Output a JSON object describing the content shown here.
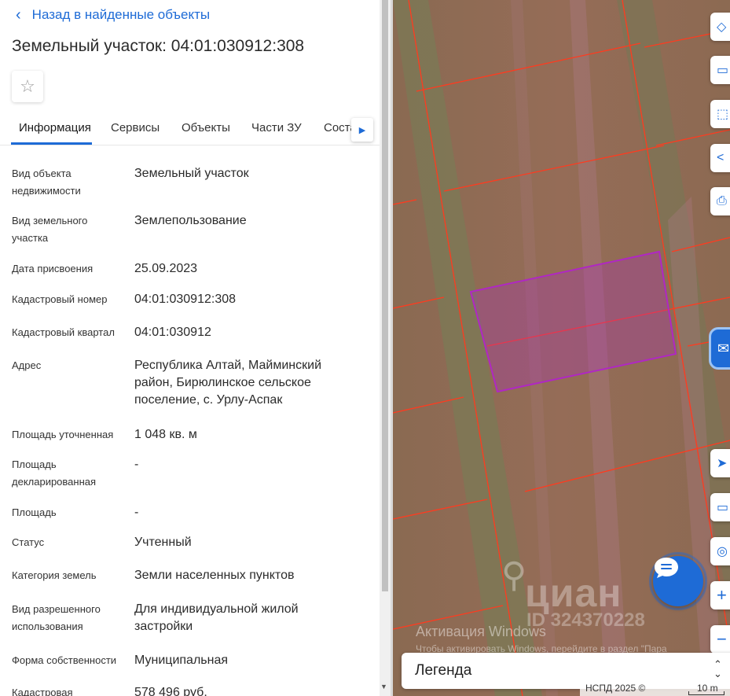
{
  "header": {
    "back_label": "Назад в найденные объекты",
    "title": "Земельный участок: 04:01:030912:308",
    "favorite_icon": "star-outline-icon"
  },
  "tabs": [
    {
      "label": "Информация",
      "active": true
    },
    {
      "label": "Сервисы",
      "active": false
    },
    {
      "label": "Объекты",
      "active": false
    },
    {
      "label": "Части ЗУ",
      "active": false
    },
    {
      "label": "Состав",
      "active": false
    }
  ],
  "info_rows": [
    {
      "label": "Вид объекта недвижимости",
      "value": "Земельный участок"
    },
    {
      "label": "Вид земельного участка",
      "value": "Землепользование"
    },
    {
      "label": "Дата присвоения",
      "value": "25.09.2023"
    },
    {
      "label": "Кадастровый номер",
      "value": "04:01:030912:308"
    },
    {
      "label": "Кадастровый квартал",
      "value": "04:01:030912"
    },
    {
      "label": "Адрес",
      "value": "Республика Алтай, Майминский район, Бирюлинское сельское поселение, с. Урлу-Аспак"
    },
    {
      "label": "Площадь уточненная",
      "value": "1 048 кв. м"
    },
    {
      "label": "Площадь декларированная",
      "value": "-"
    },
    {
      "label": "Площадь",
      "value": "-"
    },
    {
      "label": "Статус",
      "value": "Учтенный"
    },
    {
      "label": "Категория земель",
      "value": "Земли населенных пунктов"
    },
    {
      "label": "Вид разрешенного использования",
      "value": "Для индивидуальной жилой застройки"
    },
    {
      "label": "Форма собственности",
      "value": "Муниципальная"
    },
    {
      "label": "Кадастровая",
      "value": "578 496 руб."
    }
  ],
  "map": {
    "tools": [
      "layers-icon",
      "ruler-icon",
      "select-area-icon",
      "share-icon",
      "print-icon"
    ],
    "tools_bottom": [
      "locate-icon",
      "screen-icon",
      "pin-icon",
      "zoom-in-icon",
      "zoom-out-icon"
    ],
    "side_button_icon": "mail-icon",
    "chat_icon": "chat-bubble-icon",
    "watermark_brand": "циан",
    "watermark_id": "ID 324370228",
    "activation_title": "Активация Windows",
    "activation_sub": "Чтобы активировать Windows, перейдите в раздел \"Пара",
    "legend_label": "Легенда",
    "attribution": "НСПД 2025 ©",
    "scale_label": "10 m",
    "parcel_color": "#b027c4",
    "boundary_color": "#ff3b1f"
  }
}
